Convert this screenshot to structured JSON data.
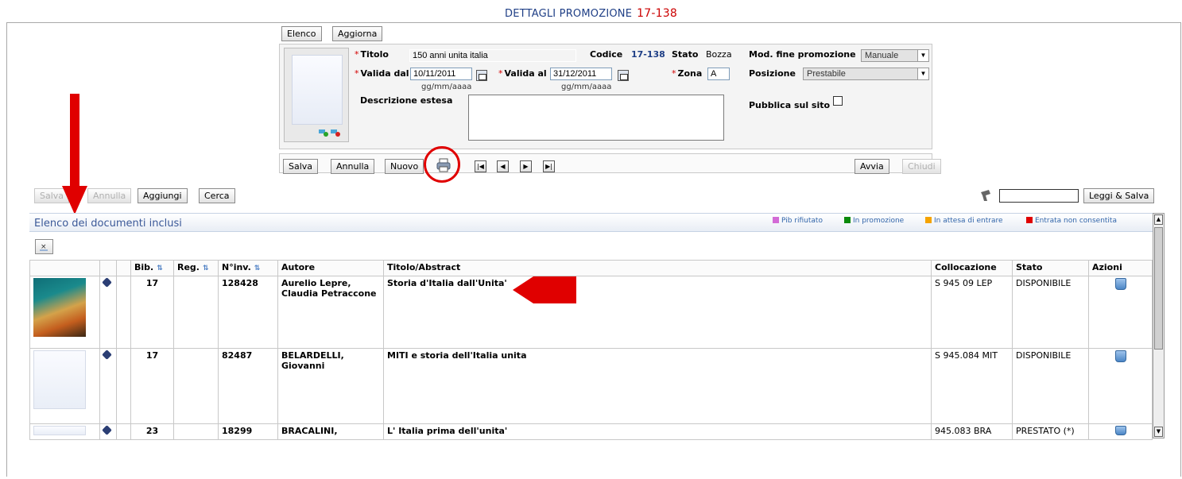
{
  "page": {
    "title": "DETTAGLI PROMOZIONE",
    "code": "17-138"
  },
  "top_buttons": {
    "elenco": "Elenco",
    "aggiorna": "Aggiorna"
  },
  "form": {
    "titolo_label": "Titolo",
    "titolo_value": "150 anni unita italia",
    "codice_label": "Codice",
    "codice_value": "17-138",
    "stato_label": "Stato",
    "stato_value": "Bozza",
    "mod_fine_label": "Mod. fine promozione",
    "mod_fine_value": "Manuale",
    "valida_dal_label": "Valida dal",
    "valida_dal_value": "10/11/2011",
    "valida_al_label": "Valida al",
    "valida_al_value": "31/12/2011",
    "date_hint": "gg/mm/aaaa",
    "zona_label": "Zona",
    "zona_value": "A",
    "posizione_label": "Posizione",
    "posizione_value": "Prestabile",
    "descrizione_label": "Descrizione estesa",
    "pubblica_label": "Pubblica sul sito"
  },
  "form_buttons": {
    "salva": "Salva",
    "annulla": "Annulla",
    "nuovo": "Nuovo",
    "avvia": "Avvia",
    "chiudi": "Chiudi"
  },
  "list_toolbar": {
    "salva": "Salva",
    "annulla": "Annulla",
    "aggiungi": "Aggiungi",
    "cerca": "Cerca",
    "leggi_salva": "Leggi & Salva"
  },
  "section": {
    "title": "Elenco dei documenti inclusi",
    "legend": [
      {
        "label": "Pib rifiutato",
        "color": "#d36bd6"
      },
      {
        "label": "In promozione",
        "color": "#0b8a0b"
      },
      {
        "label": "In attesa di entrare",
        "color": "#f5a300"
      },
      {
        "label": "Entrata non consentita",
        "color": "#e00000"
      }
    ]
  },
  "table": {
    "headers": [
      "Bib.",
      "Reg.",
      "N°inv.",
      "Autore",
      "Titolo/Abstract",
      "Collocazione",
      "Stato",
      "Azioni"
    ],
    "rows": [
      {
        "bib": "17",
        "reg": "",
        "inv": "128428",
        "autore": "Aurelio Lepre, Claudia Petraccone",
        "titolo": "Storia d'Italia dall'Unita'",
        "collocazione": "S 945 09 LEP",
        "stato": "DISPONIBILE"
      },
      {
        "bib": "17",
        "reg": "",
        "inv": "82487",
        "autore": "BELARDELLI, Giovanni",
        "titolo": "MITI e storia dell'Italia unita",
        "collocazione": "S 945.084 MIT",
        "stato": "DISPONIBILE"
      },
      {
        "bib": "23",
        "reg": "",
        "inv": "18299",
        "autore": "BRACALINI,",
        "titolo": "L' Italia prima dell'unita'",
        "collocazione": "945.083 BRA",
        "stato": "PRESTATO (*)"
      }
    ]
  },
  "colors": {
    "accent_red": "#e00000",
    "title_blue": "#1f3f86",
    "link_blue": "#3b5998"
  }
}
